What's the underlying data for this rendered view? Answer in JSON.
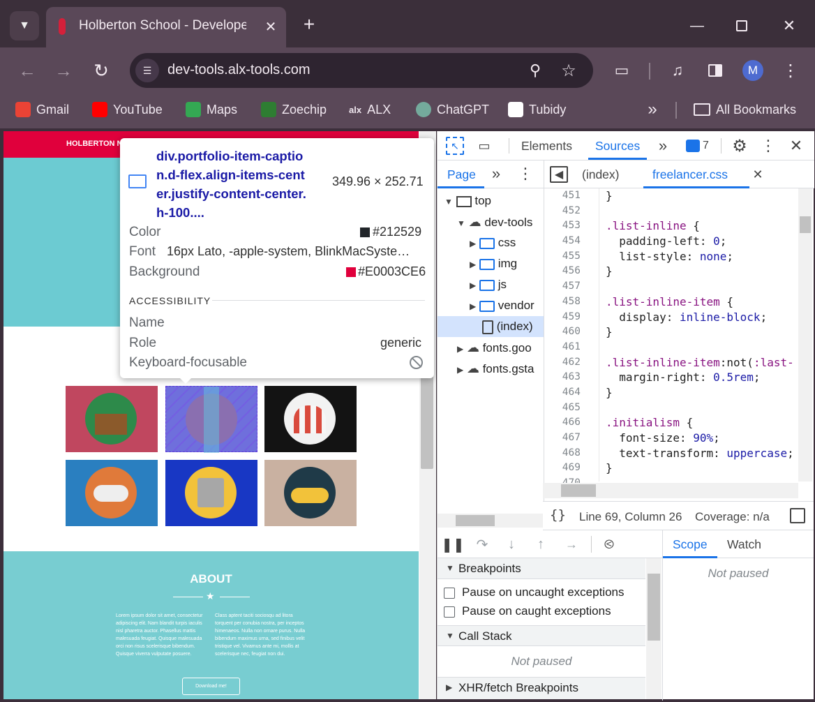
{
  "tab": {
    "title": "Holberton School - Developer t"
  },
  "omnibox": {
    "url": "dev-tools.alx-tools.com"
  },
  "bookmarks": [
    {
      "label": "Gmail",
      "color": "#ea4335"
    },
    {
      "label": "YouTube",
      "color": "#ff0000"
    },
    {
      "label": "Maps",
      "color": "#34a853"
    },
    {
      "label": "Zoechip",
      "color": "#2e7d32"
    },
    {
      "label": "ALX",
      "color": "#1f1f1f"
    },
    {
      "label": "ChatGPT",
      "color": "#74aa9c"
    },
    {
      "label": "Tubidy",
      "color": "#ffffff"
    }
  ],
  "bookmarks_all": "All Bookmarks",
  "profile_initial": "M",
  "page": {
    "header_text": "HOLBERTON N",
    "about_title": "ABOUT",
    "about_col1": "Lorem ipsum dolor sit amet, consectetur adipiscing elit. Nam blandit turpis iaculis nisl pharetra auctor. Phasellus mattis malesuada feugiat. Quisque malesuada orci non risus scelerisque bibendum. Quisque viverra vulputate posuere.",
    "about_col2": "Class aptent taciti sociosqu ad litora torquent per conubia nostra, per inceptos himenaeos. Nulla non ornare purus. Nulla bibendum maximus urna, sed finibus velit tristique vel. Vivamus ante mi, mollis at scelerisque nec, feugiat non dui.",
    "download_label": "Download me!",
    "portfolio_colors": [
      "#c0475f",
      "#6a6ad8",
      "#131313",
      "#2a7fc0",
      "#1837c4",
      "#c9b1a1"
    ]
  },
  "tooltip": {
    "selector": "div.portfolio-item-caption.d-flex.align-items-center.justify-content-center.h-100....",
    "selector_lines": [
      "div.portfolio-item-captio",
      "n.d-flex.align-items-cent",
      "er.justify-content-center.",
      "h-100...."
    ],
    "size": "349.96 × 252.71",
    "color_label": "Color",
    "color_value": "#212529",
    "font_label": "Font",
    "font_value": "16px Lato, -apple-system, BlinkMacSyste…",
    "background_label": "Background",
    "background_value": "#E0003CE6",
    "accessibility_heading": "ACCESSIBILITY",
    "name_label": "Name",
    "role_label": "Role",
    "role_value": "generic",
    "keyboard_label": "Keyboard-focusable"
  },
  "devtools": {
    "tabs": [
      "Elements",
      "Sources"
    ],
    "issues_count": "7",
    "nav_tab": "Page",
    "file_tabs": [
      "(index)",
      "freelancer.css"
    ],
    "tree": [
      "top",
      "dev-tools",
      "css",
      "img",
      "js",
      "vendor",
      "(index)",
      "fonts.goo",
      "fonts.gsta"
    ],
    "line_numbers": [
      "451",
      "452",
      "453",
      "454",
      "455",
      "456",
      "457",
      "458",
      "459",
      "460",
      "461",
      "462",
      "463",
      "464",
      "465",
      "466",
      "467",
      "468",
      "469",
      "470"
    ],
    "status_position": "Line 69, Column 26",
    "status_coverage": "Coverage: n/a",
    "breakpoints_title": "Breakpoints",
    "pause_uncaught": "Pause on uncaught exceptions",
    "pause_caught": "Pause on caught exceptions",
    "call_stack_title": "Call Stack",
    "not_paused": "Not paused",
    "xhr_title": "XHR/fetch Breakpoints",
    "scope_tab": "Scope",
    "watch_tab": "Watch",
    "scope_not_paused": "Not paused"
  }
}
